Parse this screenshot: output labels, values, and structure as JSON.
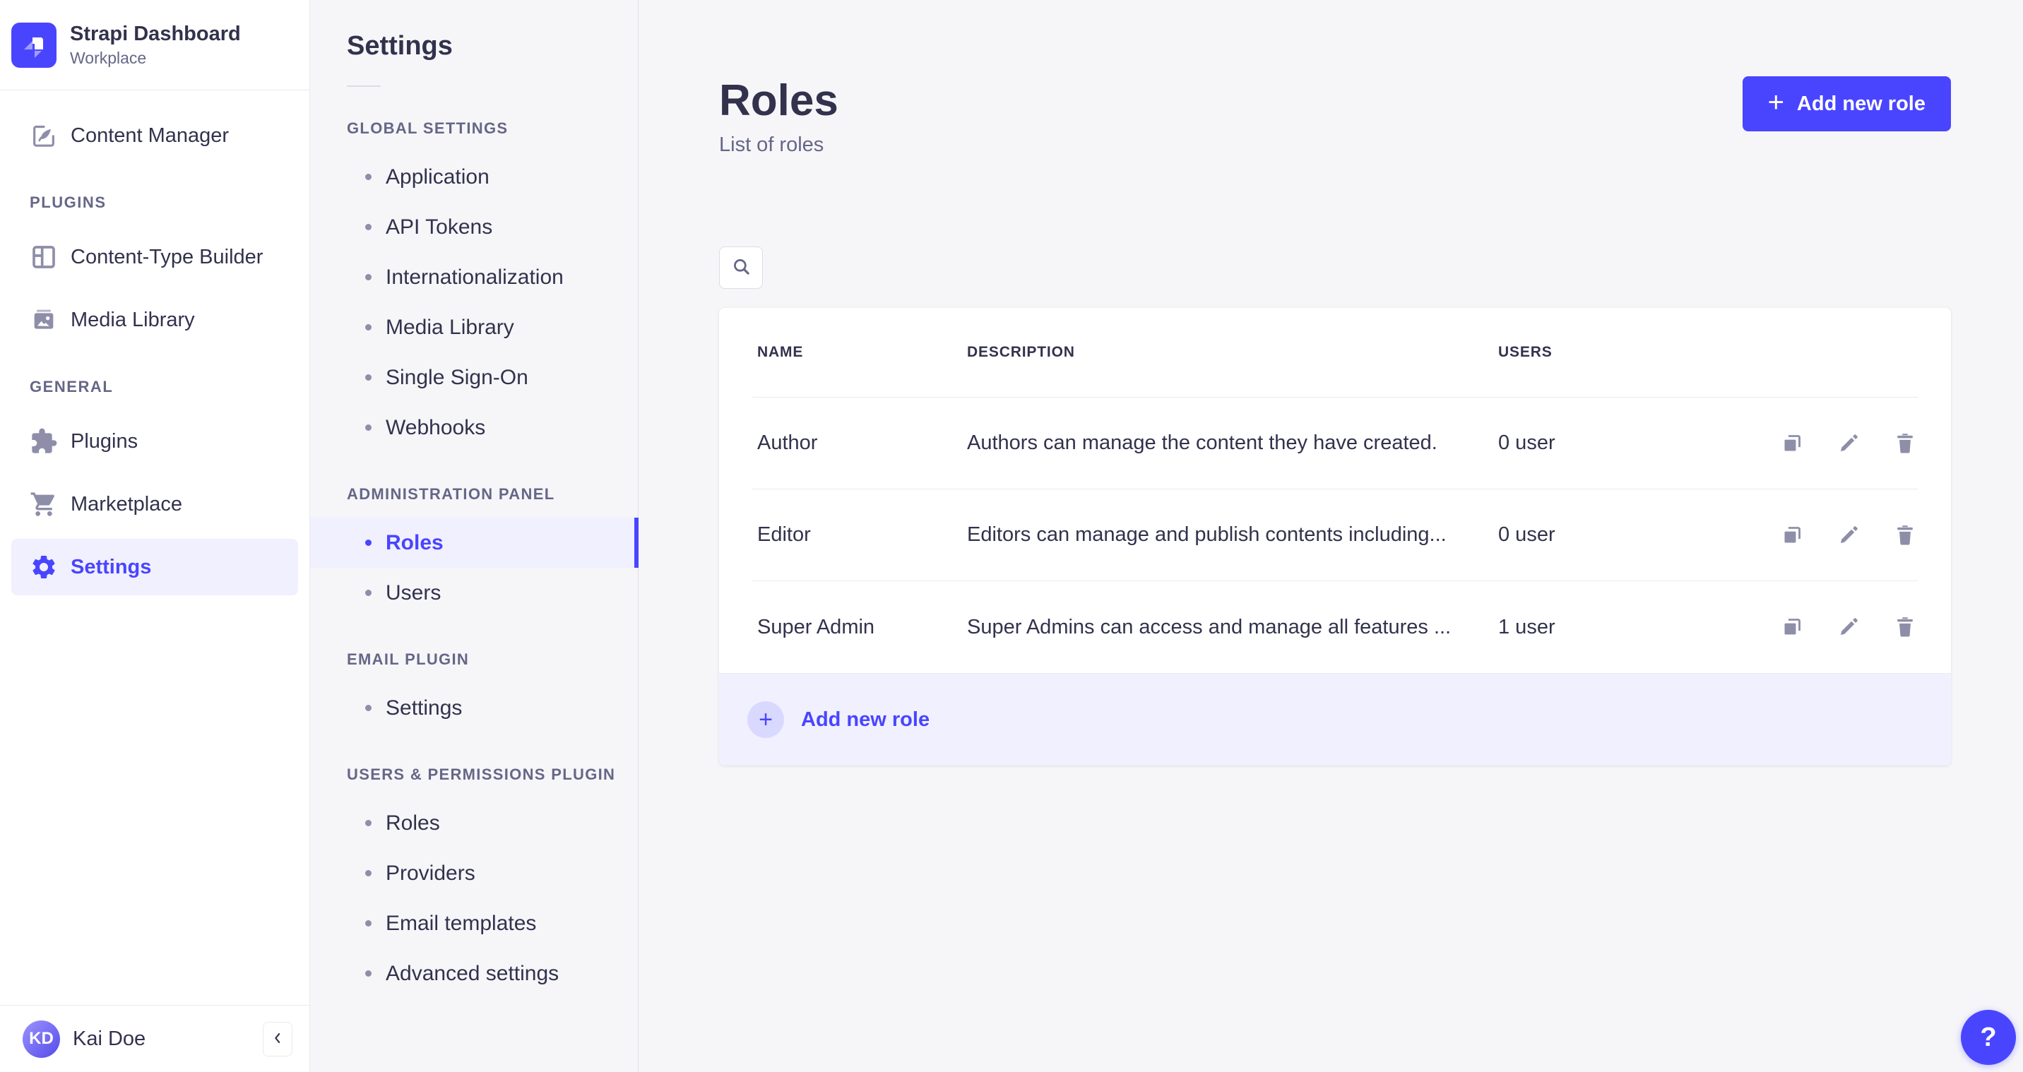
{
  "brand": {
    "title": "Strapi Dashboard",
    "subtitle": "Workplace"
  },
  "sidebar": {
    "content_manager_label": "Content Manager",
    "sections": [
      {
        "label": "PLUGINS",
        "items": [
          {
            "label": "Content-Type Builder"
          },
          {
            "label": "Media Library"
          }
        ]
      },
      {
        "label": "GENERAL",
        "items": [
          {
            "label": "Plugins"
          },
          {
            "label": "Marketplace"
          },
          {
            "label": "Settings"
          }
        ]
      }
    ],
    "user": {
      "initials": "KD",
      "name": "Kai Doe"
    }
  },
  "settings_panel": {
    "title": "Settings",
    "sections": [
      {
        "label": "GLOBAL SETTINGS",
        "items": [
          "Application",
          "API Tokens",
          "Internationalization",
          "Media Library",
          "Single Sign-On",
          "Webhooks"
        ]
      },
      {
        "label": "ADMINISTRATION PANEL",
        "items": [
          "Roles",
          "Users"
        ]
      },
      {
        "label": "EMAIL PLUGIN",
        "items": [
          "Settings"
        ]
      },
      {
        "label": "USERS & PERMISSIONS PLUGIN",
        "items": [
          "Roles",
          "Providers",
          "Email templates",
          "Advanced settings"
        ]
      }
    ],
    "active_item": "Roles"
  },
  "page": {
    "title": "Roles",
    "subtitle": "List of roles",
    "add_button_label": "Add new role",
    "plus_glyph": "+",
    "table": {
      "headers": {
        "name": "NAME",
        "description": "DESCRIPTION",
        "users": "USERS"
      },
      "rows": [
        {
          "name": "Author",
          "description": "Authors can manage the content they have created.",
          "users": "0 user"
        },
        {
          "name": "Editor",
          "description": "Editors can manage and publish contents including...",
          "users": "0 user"
        },
        {
          "name": "Super Admin",
          "description": "Super Admins can access and manage all features ...",
          "users": "1 user"
        }
      ],
      "row_action_icons": [
        "duplicate-icon",
        "edit-icon",
        "delete-icon"
      ],
      "footer_add_label": "Add new role"
    }
  },
  "help_label": "?",
  "colors": {
    "accent": "#4945ff",
    "accent_soft": "#f0f0ff",
    "text": "#32324d",
    "muted": "#666687",
    "icon_muted": "#8e8ea9",
    "border": "#eaeaef",
    "surface": "#ffffff",
    "app_bg": "#f6f6f9"
  }
}
